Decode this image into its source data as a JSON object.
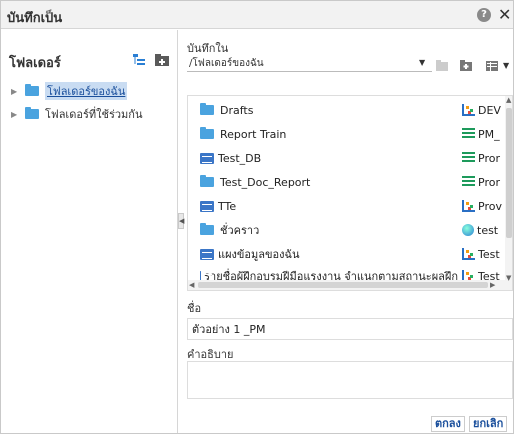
{
  "dialog": {
    "title": "บันทึกเป็น"
  },
  "left": {
    "header": "โฟลเดอร์",
    "tree": [
      {
        "label": "โฟลเดอร์ของฉัน",
        "selected": true
      },
      {
        "label": "โฟลเดอร์ที่ใช้ร่วมกัน",
        "selected": false
      }
    ]
  },
  "right": {
    "save_in_label": "บันทึกใน",
    "path": "/โฟลเดอร์ของฉัน",
    "files": [
      {
        "name": "Drafts",
        "icon": "folder-icon"
      },
      {
        "name": "Report Train",
        "icon": "folder-icon"
      },
      {
        "name": "Test_DB",
        "icon": "table-icon"
      },
      {
        "name": "Test_Doc_Report",
        "icon": "folder-icon"
      },
      {
        "name": "TTe",
        "icon": "table-icon"
      },
      {
        "name": "ชั่วคราว",
        "icon": "folder-icon"
      },
      {
        "name": "แผงข้อมูลของฉัน",
        "icon": "table-icon"
      },
      {
        "name": "รายชื่อผู้ฝึกอบรมฝีมือแรงงาน จำแนกตามสถานะผลฝึก",
        "icon": "table-icon"
      }
    ],
    "files_col2": [
      {
        "name": "DEV",
        "icon": "chart-icon"
      },
      {
        "name": "PM_",
        "icon": "list-icon"
      },
      {
        "name": "Pror",
        "icon": "list-icon"
      },
      {
        "name": "Pror",
        "icon": "list-icon"
      },
      {
        "name": "Prov",
        "icon": "chart-icon"
      },
      {
        "name": "test",
        "icon": "globe-icon"
      },
      {
        "name": "Test",
        "icon": "chart-icon"
      },
      {
        "name": "Test",
        "icon": "chart-icon"
      }
    ],
    "name_label": "ชื่อ",
    "name_value": "ตัวอย่าง 1 _PM",
    "description_label": "คำอธิบาย",
    "description_value": ""
  },
  "buttons": {
    "ok": "ตกลง",
    "cancel": "ยกเลิก"
  },
  "colors": {
    "folder": "#4aa3df",
    "accent": "#1a4f9c",
    "selected_bg": "#c9dcf2"
  }
}
